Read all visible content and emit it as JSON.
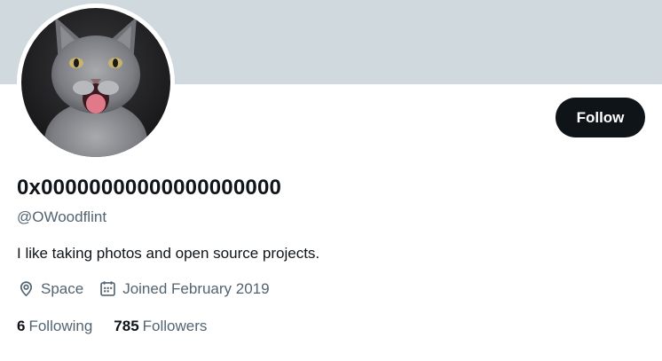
{
  "profile": {
    "display_name": "0x00000000000000000000",
    "handle": "@OWoodflint",
    "bio": "I like taking photos and open source projects.",
    "location": "Space",
    "joined": "Joined February 2019",
    "avatar_description": "grey kitten with open mouth"
  },
  "actions": {
    "follow_label": "Follow"
  },
  "stats": {
    "following_count": "6",
    "following_label": "Following",
    "followers_count": "785",
    "followers_label": "Followers"
  },
  "icons": {
    "location": "location-pin-icon",
    "calendar": "calendar-icon"
  },
  "colors": {
    "banner": "#cfd9de",
    "button_bg": "#0f1419",
    "secondary_text": "#536471",
    "primary_text": "#0f1419"
  }
}
